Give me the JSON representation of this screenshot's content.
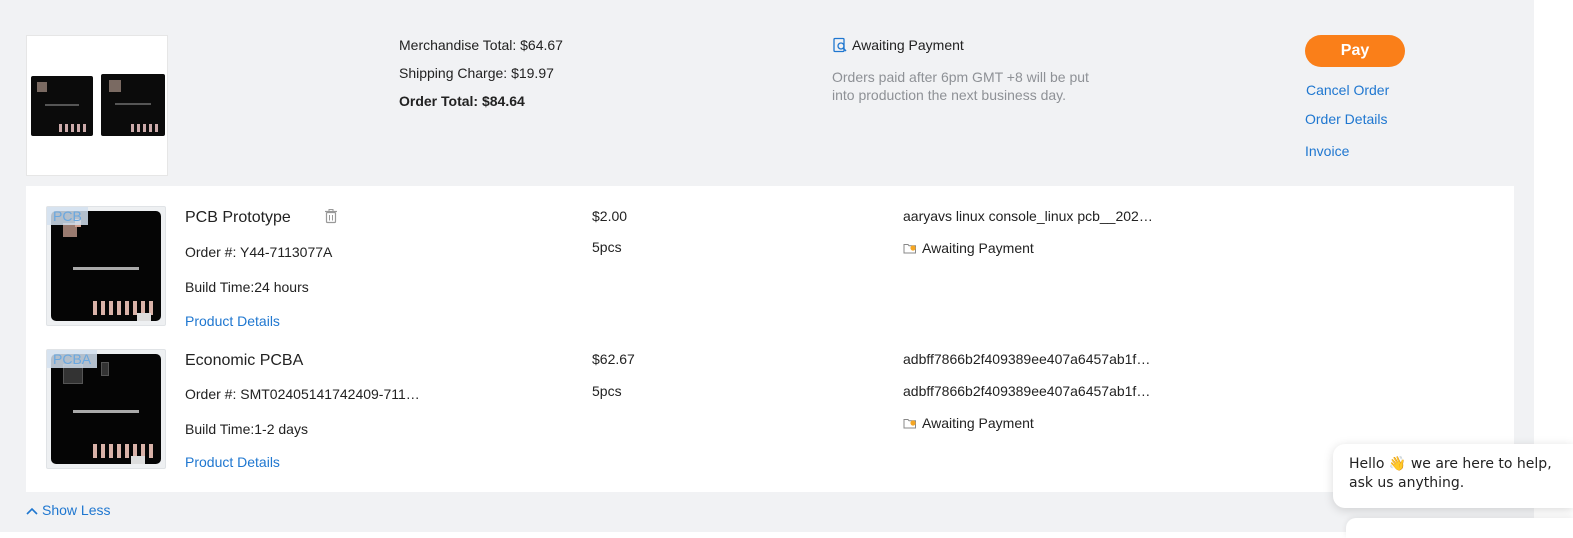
{
  "order": {
    "merchandise_total": "Merchandise Total: $64.67",
    "shipping_charge": "Shipping Charge: $19.97",
    "order_total": "Order Total: $84.64",
    "status": "Awaiting Payment",
    "hint": "Orders paid after 6pm GMT +8 will be put into production the next business day.",
    "actions": {
      "pay": "Pay",
      "cancel": "Cancel Order",
      "details": "Order Details",
      "invoice": "Invoice"
    }
  },
  "items": [
    {
      "tag": "PCB",
      "title": "PCB Prototype",
      "order_no": "Order #: Y44-7113077A",
      "build_time": "Build Time:24 hours",
      "details_link": "Product Details",
      "price": "$2.00",
      "qty": "5pcs",
      "file_name": "aaryavs linux console_linux pcb__202…",
      "status": "Awaiting Payment"
    },
    {
      "tag": "PCBA",
      "title": "Economic PCBA",
      "order_no": "Order #: SMT02405141742409-711…",
      "build_time": "Build Time:1-2 days",
      "details_link": "Product Details",
      "price": "$62.67",
      "qty": "5pcs",
      "file_name": "adbff7866b2f409389ee407a6457ab1f…",
      "file_name_2": "adbff7866b2f409389ee407a6457ab1f…",
      "status": "Awaiting Payment"
    }
  ],
  "show_less": "Show Less",
  "chat": {
    "message": "Hello 👋 we are here to help, ask us anything."
  },
  "colors": {
    "accent_orange": "#fa7f19",
    "link_blue": "#1f77d0",
    "panel_bg": "#f1f2f4"
  },
  "icons": [
    "search-doc-icon",
    "trash-icon",
    "file-status-icon",
    "chevron-up-icon"
  ]
}
